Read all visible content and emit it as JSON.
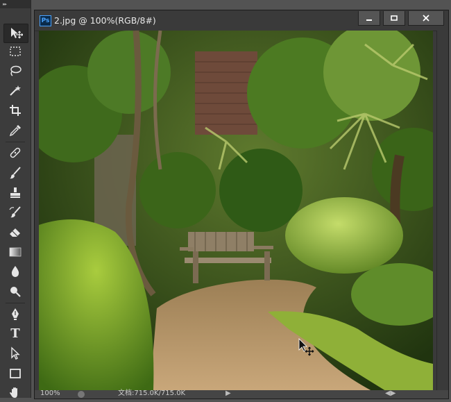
{
  "app": {
    "toolbar_grip": "▸▸"
  },
  "document": {
    "ps_badge": "Ps",
    "title": "2.jpg @ 100%(RGB/8#)",
    "minimize_label": "minimize",
    "restore_label": "restore",
    "close_label": "close"
  },
  "tools": [
    {
      "name": "move-tool",
      "icon": "move-icon",
      "active": true
    },
    {
      "name": "marquee-tool",
      "icon": "rect-marquee-icon"
    },
    {
      "name": "lasso-tool",
      "icon": "lasso-icon"
    },
    {
      "name": "magic-wand-tool",
      "icon": "magic-wand-icon"
    },
    {
      "name": "crop-tool",
      "icon": "crop-icon"
    },
    {
      "name": "eyedropper-tool",
      "icon": "eyedropper-icon"
    },
    {
      "name": "healing-tool",
      "icon": "bandage-icon"
    },
    {
      "name": "brush-tool",
      "icon": "brush-icon"
    },
    {
      "name": "stamp-tool",
      "icon": "stamp-icon"
    },
    {
      "name": "history-brush-tool",
      "icon": "history-brush-icon"
    },
    {
      "name": "eraser-tool",
      "icon": "eraser-icon"
    },
    {
      "name": "gradient-tool",
      "icon": "gradient-icon"
    },
    {
      "name": "blur-tool",
      "icon": "drop-icon"
    },
    {
      "name": "dodge-tool",
      "icon": "dodge-icon"
    },
    {
      "name": "pen-tool",
      "icon": "pen-icon"
    },
    {
      "name": "type-tool",
      "icon": "type-icon",
      "label": "T"
    },
    {
      "name": "path-selection-tool",
      "icon": "arrow-icon"
    },
    {
      "name": "shape-tool",
      "icon": "rectangle-icon"
    },
    {
      "name": "hand-tool",
      "icon": "hand-icon"
    }
  ],
  "status": {
    "zoom": "100%",
    "doc_info": "文档:715.0K/715.0K",
    "arrow": "▶",
    "right_indicator": "◀▶"
  },
  "colors": {
    "accent": "#4aa3ff",
    "toolbar_bg": "#3c3c3c",
    "workspace_bg": "#535353"
  }
}
